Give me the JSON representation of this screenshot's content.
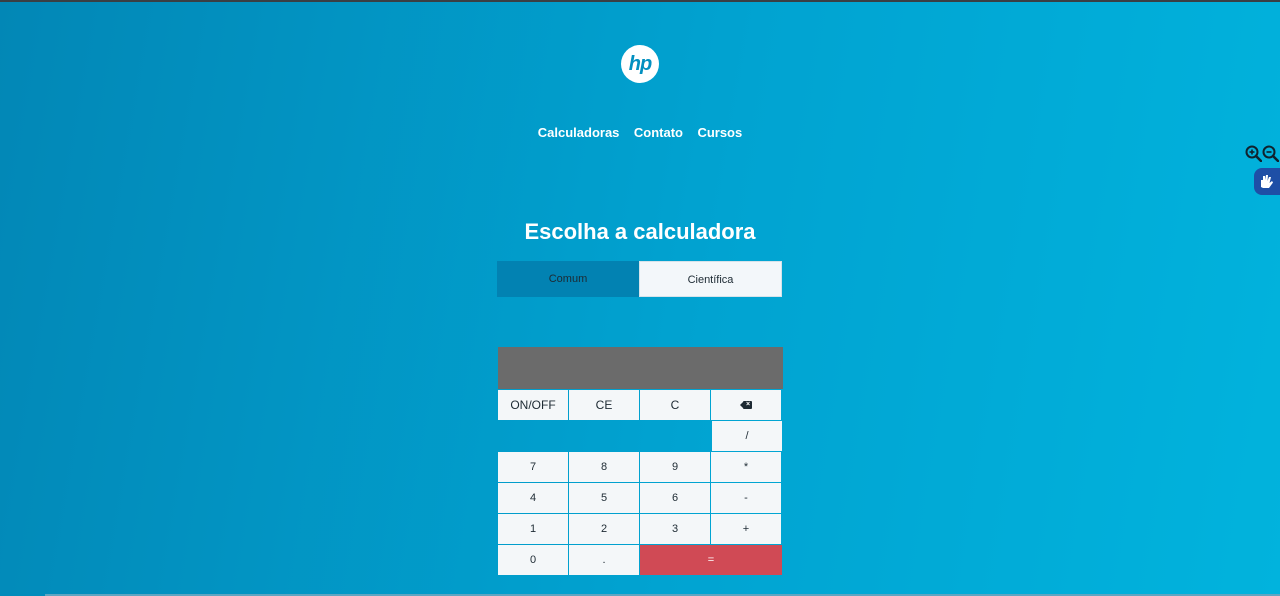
{
  "logo": {
    "text": "hp"
  },
  "nav": {
    "items": [
      "Calculadoras",
      "Contato",
      "Cursos"
    ]
  },
  "title": "Escolha a calculadora",
  "tabs": [
    {
      "label": "Comum",
      "active": true
    },
    {
      "label": "Científica",
      "active": false
    }
  ],
  "calculator": {
    "display_value": "",
    "row1": [
      "ON/OFF",
      "CE",
      "C"
    ],
    "divide": "/",
    "row3": [
      "7",
      "8",
      "9",
      "*"
    ],
    "row4": [
      "4",
      "5",
      "6",
      "-"
    ],
    "row5": [
      "1",
      "2",
      "3",
      "+"
    ],
    "row6": [
      "0",
      ".",
      "="
    ]
  },
  "accessibility": {
    "zoom_in_icon": "zoom-in-icon",
    "zoom_out_icon": "zoom-out-icon",
    "sign_language_icon": "hand-icon"
  },
  "colors": {
    "accent": "#0282b2",
    "equals": "#d04a55",
    "display": "#6b6b6b"
  }
}
